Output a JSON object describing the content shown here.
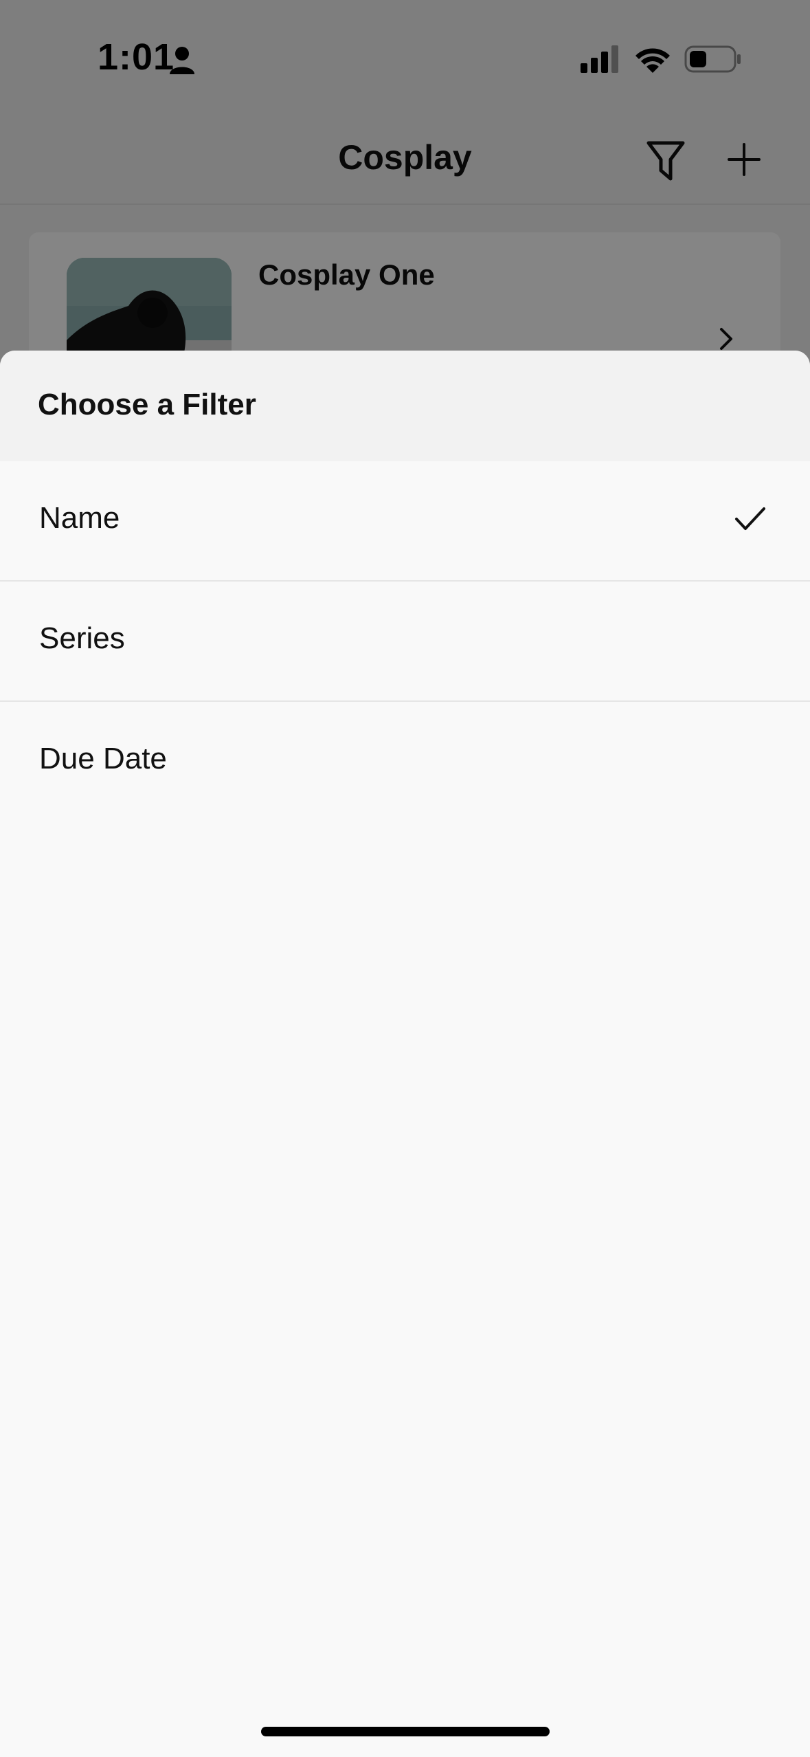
{
  "status_bar": {
    "time": "1:01",
    "icons": [
      "person-icon",
      "cellular-signal-icon",
      "wifi-icon",
      "battery-icon"
    ]
  },
  "nav": {
    "title": "Cosplay",
    "actions": [
      "filter-icon",
      "plus-icon"
    ]
  },
  "list": {
    "items": [
      {
        "title": "Cosplay One"
      }
    ]
  },
  "sheet": {
    "title": "Choose a Filter",
    "options": [
      {
        "label": "Name",
        "selected": true
      },
      {
        "label": "Series",
        "selected": false
      },
      {
        "label": "Due Date",
        "selected": false
      }
    ]
  },
  "colors": {
    "sheet_background": "#f9f9f9",
    "sheet_header": "#f2f2f2",
    "text": "#111111"
  }
}
